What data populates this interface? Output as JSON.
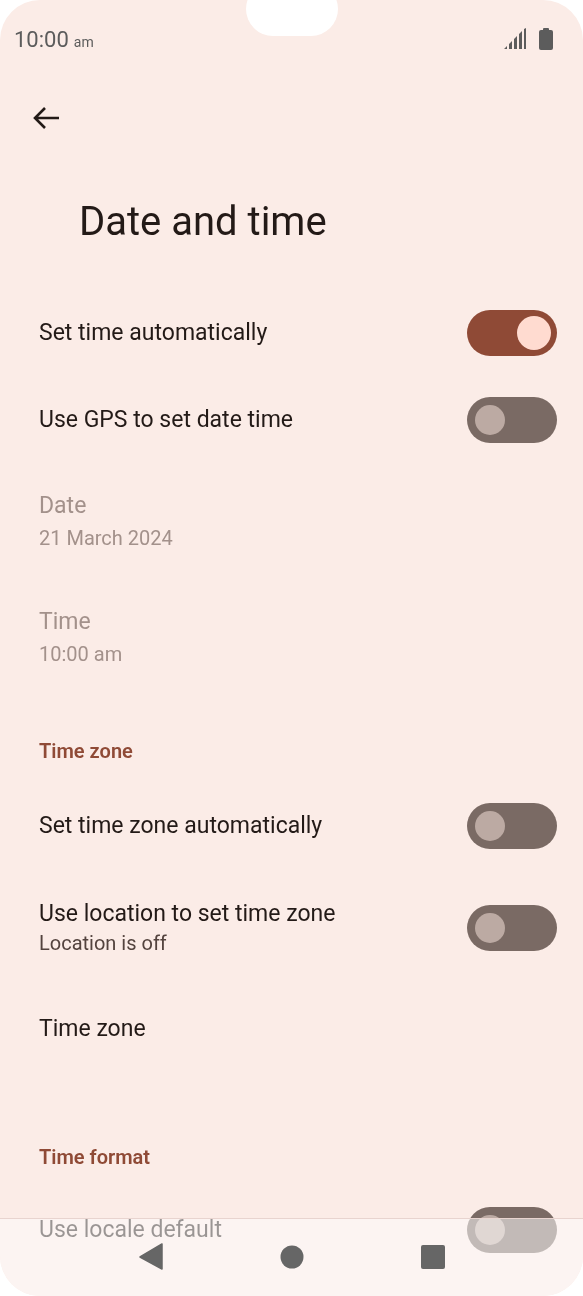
{
  "status_bar": {
    "time": "10:00",
    "time_suffix": "am"
  },
  "title": "Date and time",
  "items": [
    {
      "kind": "toggle",
      "title": "Set time automatically",
      "on": true
    },
    {
      "kind": "toggle",
      "title": "Use GPS to set date time",
      "on": false
    },
    {
      "kind": "info",
      "title": "Date",
      "value": "21 March 2024",
      "disabled": true
    },
    {
      "kind": "info",
      "title": "Time",
      "value": "10:00 am",
      "disabled": true
    },
    {
      "kind": "header",
      "title": "Time zone"
    },
    {
      "kind": "toggle",
      "title": "Set time zone automatically",
      "on": false
    },
    {
      "kind": "toggle",
      "title": "Use location to set time zone",
      "subtitle": "Location is off",
      "on": false
    },
    {
      "kind": "link",
      "title": "Time zone"
    },
    {
      "kind": "header",
      "title": "Time format"
    },
    {
      "kind": "toggle",
      "title": "Use locale default",
      "on": false
    }
  ]
}
